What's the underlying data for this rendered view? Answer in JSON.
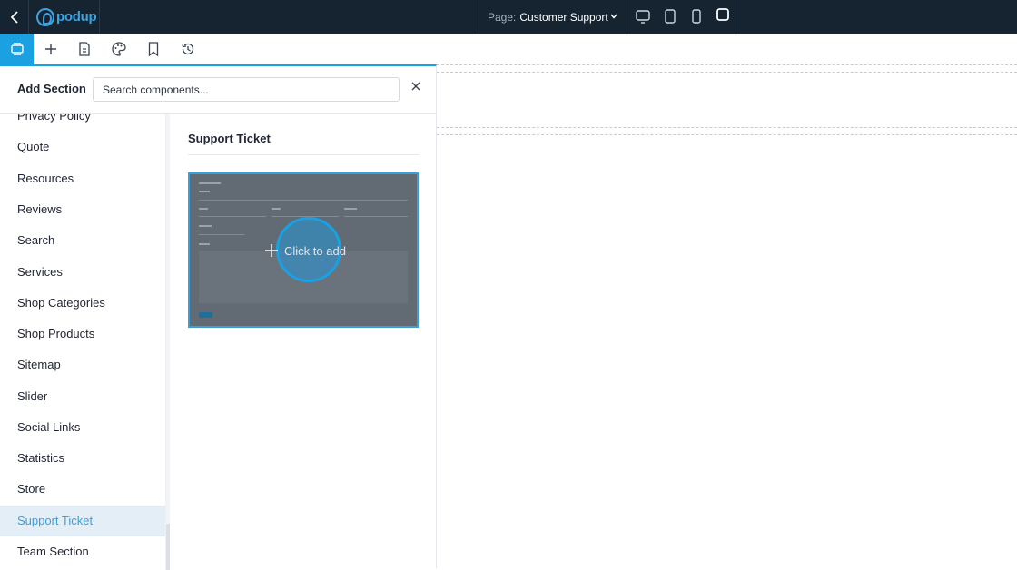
{
  "topbar": {
    "brand": "podup",
    "page_prefix": "Page:",
    "page_name": "Customer Support",
    "devices": [
      "desktop-icon",
      "tablet-icon",
      "mobile-icon",
      "square-icon"
    ]
  },
  "toolbar": {
    "tools": [
      "sections-icon",
      "plus-icon",
      "page-icon",
      "palette-icon",
      "bookmark-icon",
      "history-icon"
    ],
    "active_tool": "sections-icon",
    "accent": "#1ba1e2"
  },
  "panel": {
    "title": "Add Section",
    "search_placeholder": "Search components...",
    "categories": [
      {
        "label": "Privacy Policy"
      },
      {
        "label": "Quote"
      },
      {
        "label": "Resources"
      },
      {
        "label": "Reviews"
      },
      {
        "label": "Search"
      },
      {
        "label": "Services"
      },
      {
        "label": "Shop Categories"
      },
      {
        "label": "Shop Products"
      },
      {
        "label": "Sitemap"
      },
      {
        "label": "Slider"
      },
      {
        "label": "Social Links"
      },
      {
        "label": "Statistics"
      },
      {
        "label": "Store"
      },
      {
        "label": "Support Ticket"
      },
      {
        "label": "Team Section"
      }
    ],
    "selected_category": "Support Ticket",
    "detail_title": "Support Ticket",
    "preview_action": "Click to add"
  }
}
